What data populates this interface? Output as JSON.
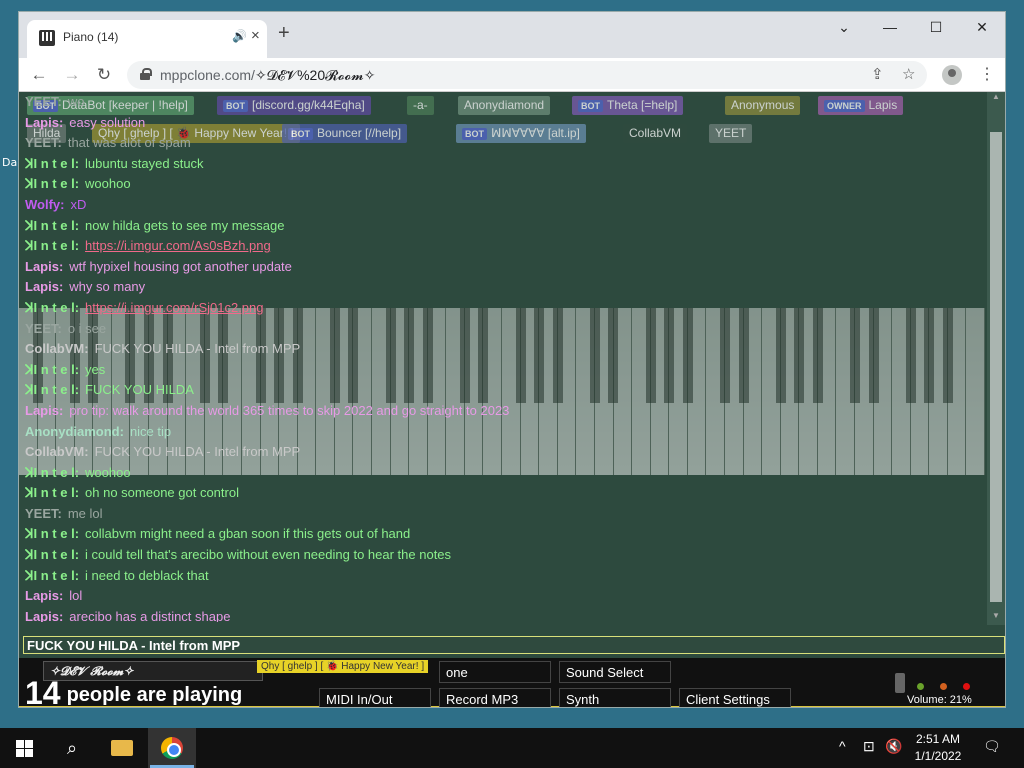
{
  "desktop": {
    "side_label": "Da"
  },
  "browser": {
    "tab_title": "Piano (14)",
    "new_tab": "+",
    "url_host": "mppclone.com/",
    "url_path": "✧𝓓𝓔𝓥%20𝓡𝓸𝓸𝓶✧",
    "controls": {
      "minimize": "—",
      "maximize": "☐",
      "close": "✕",
      "tab_search": "⌄"
    }
  },
  "user_bar": [
    {
      "tag": "BOT",
      "text": "DataBot [keeper | !help]",
      "color": "#5a9b6c"
    },
    {
      "tag": "BOT",
      "text": "[discord.gg/k44Eqha]",
      "color": "#5e4a9e"
    },
    {
      "tag": "",
      "text": "-a-",
      "color": "#4b7a57"
    },
    {
      "tag": "",
      "text": "Anonydiamond",
      "color": "#6d8f7c"
    },
    {
      "tag": "BOT",
      "text": "Theta [=help]",
      "color": "#7c5bb1"
    },
    {
      "tag": "",
      "text": "Anonymous",
      "color": "#8b8a3e"
    },
    {
      "tag": "OWNER",
      "text": "Lapis",
      "color": "#9c5fa6"
    },
    {
      "tag": "",
      "text": "Hilda",
      "color": "#6d7a75"
    },
    {
      "tag": "",
      "text": "Qhy [ ghelp ] [ 🐞 Happy New Year! ]",
      "color": "#9a9134"
    },
    {
      "tag": "BOT",
      "text": "Bouncer [//help]",
      "color": "#4c5fa8"
    },
    {
      "tag": "BOT",
      "text": "ꟽꟽ∀∀∀∀ [alt.ip]",
      "color": "#6a8fb0"
    },
    {
      "tag": "",
      "text": "CollabVM",
      "color": "#2f4a3e"
    },
    {
      "tag": "",
      "text": "YEET",
      "color": "#6d7f79"
    }
  ],
  "chat": [
    {
      "nick": "YEET:",
      "text": "wo",
      "color": "#9aa6a0"
    },
    {
      "nick": "Lapis:",
      "text": "easy solution",
      "color": "#e79ae6"
    },
    {
      "nick": "YEET:",
      "text": "that was alot of spam",
      "color": "#9aa6a0"
    },
    {
      "nick": "ꓘI n t e l:",
      "text": "lubuntu stayed stuck",
      "color": "#8bf08b"
    },
    {
      "nick": "ꓘI n t e l:",
      "text": "woohoo",
      "color": "#8bf08b"
    },
    {
      "nick": "Wolfy:",
      "text": "xD",
      "color": "#c05cf0"
    },
    {
      "nick": "ꓘI n t e l:",
      "text": "now hilda gets to see my message",
      "color": "#8bf08b"
    },
    {
      "nick": "ꓘI n t e l:",
      "text": "https://i.imgur.com/As0sBzh.png",
      "color": "#8bf08b",
      "link": true
    },
    {
      "nick": "Lapis:",
      "text": "wtf hypixel housing got another update",
      "color": "#e79ae6"
    },
    {
      "nick": "Lapis:",
      "text": "why so many",
      "color": "#e79ae6"
    },
    {
      "nick": "ꓘI n t e l:",
      "text": "https://i.imgur.com/rSj01c2.png",
      "color": "#8bf08b",
      "link": true
    },
    {
      "nick": "YEET:",
      "text": "o i see",
      "color": "#9aa6a0"
    },
    {
      "nick": "CollabVM:",
      "text": "FUCK YOU HILDA - Intel from MPP",
      "color": "#c9c9c9"
    },
    {
      "nick": "ꓘI n t e l:",
      "text": "yes",
      "color": "#8bf08b"
    },
    {
      "nick": "ꓘI n t e l:",
      "text": "FUCK YOU HILDA",
      "color": "#8bf08b"
    },
    {
      "nick": "Lapis:",
      "text": "pro tip: walk around the world 365 times to skip 2022 and go straight to 2023",
      "color": "#e79ae6"
    },
    {
      "nick": "Anonydiamond:",
      "text": "nice tip",
      "color": "#a8e0c4"
    },
    {
      "nick": "CollabVM:",
      "text": "FUCK YOU HILDA - Intel from MPP",
      "color": "#c9c9c9"
    },
    {
      "nick": "ꓘI n t e l:",
      "text": "woohoo",
      "color": "#8bf08b"
    },
    {
      "nick": "ꓘI n t e l:",
      "text": "oh no someone got control",
      "color": "#8bf08b"
    },
    {
      "nick": "YEET:",
      "text": "me lol",
      "color": "#9aa6a0"
    },
    {
      "nick": "ꓘI n t e l:",
      "text": "collabvm might need a gban soon if this gets out of hand",
      "color": "#8bf08b"
    },
    {
      "nick": "ꓘI n t e l:",
      "text": "i could tell that's arecibo without even needing to hear the notes",
      "color": "#8bf08b"
    },
    {
      "nick": "ꓘI n t e l:",
      "text": "i need to deblack that",
      "color": "#8bf08b"
    },
    {
      "nick": "Lapis:",
      "text": "lol",
      "color": "#e79ae6"
    },
    {
      "nick": "Lapis:",
      "text": "arecibo has a distinct shape",
      "color": "#e79ae6"
    }
  ],
  "chat_input": {
    "value": "FUCK YOU HILDA - Intel from MPP"
  },
  "bottom": {
    "room": "✧𝓓𝓔𝓥 𝓡𝓸𝓸𝓶✧",
    "people_count": "14",
    "people_label": "people are playing",
    "buttons": {
      "new_room": "one",
      "sound_select": "Sound Select",
      "midi": "MIDI In/Out",
      "record": "Record MP3",
      "synth": "Synth",
      "client_settings": "Client Settings"
    },
    "room_overlay": "Qhy [ ghelp ] [ 🐞 Happy New Year! ]",
    "volume": "Volume: 21%"
  },
  "taskbar": {
    "time": "2:51 AM",
    "date": "1/1/2022"
  }
}
